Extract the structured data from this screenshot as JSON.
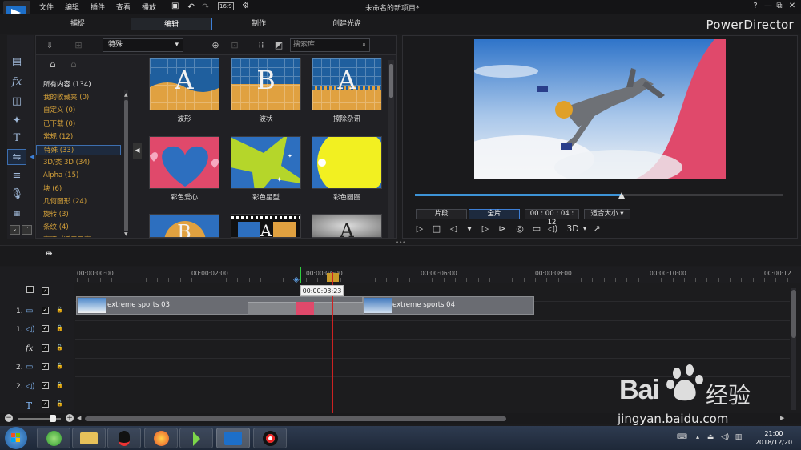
{
  "menu": [
    "文件",
    "编辑",
    "插件",
    "查看",
    "播放"
  ],
  "toolbar_timecode": "16:9",
  "document_title": "未命名的新项目*",
  "window_controls": [
    "?",
    "—",
    "⧉",
    "✕"
  ],
  "modes": [
    "捕捉",
    "编辑",
    "制作",
    "创建光盘"
  ],
  "active_mode": "编辑",
  "brand": "PowerDirector",
  "library": {
    "category_select": "特殊",
    "search_placeholder": "搜索库",
    "categories": [
      {
        "label": "所有内容 (134)",
        "color": "white"
      },
      {
        "label": "我的收藏夹 (0)",
        "color": "orange"
      },
      {
        "label": "自定义 (0)",
        "color": "orange"
      },
      {
        "label": "已下载 (0)",
        "color": "orange"
      },
      {
        "label": "常规 (12)",
        "color": "orange"
      },
      {
        "label": "特殊 (33)",
        "color": "orange",
        "selected": true
      },
      {
        "label": "3D/类 3D (34)",
        "color": "orange"
      },
      {
        "label": "Alpha (15)",
        "color": "orange"
      },
      {
        "label": "块 (6)",
        "color": "orange"
      },
      {
        "label": "几何图形 (24)",
        "color": "orange"
      },
      {
        "label": "旋转 (3)",
        "color": "orange"
      },
      {
        "label": "条纹 (4)",
        "color": "orange"
      },
      {
        "label": "套项（适用于套",
        "color": "orange"
      }
    ],
    "tiles": [
      {
        "label": "波形",
        "letter": "A"
      },
      {
        "label": "波状",
        "letter": "B"
      },
      {
        "label": "擦除杂讯",
        "letter": "A"
      },
      {
        "label": "彩色爱心",
        "letter": ""
      },
      {
        "label": "彩色星型",
        "letter": ""
      },
      {
        "label": "彩色圆圈",
        "letter": ""
      },
      {
        "label": "",
        "letter": "B"
      },
      {
        "label": "",
        "letter": "A"
      },
      {
        "label": "",
        "letter": "A"
      }
    ]
  },
  "preview": {
    "progress": 0.56,
    "clip_label": "片段",
    "movie_label": "全片",
    "timecode": "00 : 00 : 04 : 12",
    "fit_label": "适合大小",
    "mode_3d": "3D"
  },
  "timeline": {
    "ruler_ticks": [
      "00:00:00:00",
      "00:00:02:00",
      "00:00:04:00",
      "00:00:06:00",
      "00:00:08:00",
      "00:00:10:00",
      "00:00:12"
    ],
    "hover_time": "00:00:03:23",
    "tracks": [
      {
        "num": "",
        "type": "header"
      },
      {
        "num": "1.",
        "type": "video"
      },
      {
        "num": "1.",
        "type": "audio"
      },
      {
        "num": "",
        "type": "fx"
      },
      {
        "num": "2.",
        "type": "video"
      },
      {
        "num": "2.",
        "type": "audio"
      },
      {
        "num": "",
        "type": "text"
      }
    ],
    "clips": [
      {
        "name": "extreme sports 03"
      },
      {
        "name": "extreme sports 04"
      }
    ]
  },
  "taskbar": {
    "time": "21:00",
    "date": "2018/12/20"
  },
  "watermark": {
    "brand": "Bai",
    "brand_cn": "经验",
    "url": "jingyan.baidu.com"
  },
  "colors": {
    "accent": "#3d7fd6",
    "category_text": "#d6a23a",
    "playhead": "#cc2222",
    "transition_pink": "#e0496b"
  }
}
